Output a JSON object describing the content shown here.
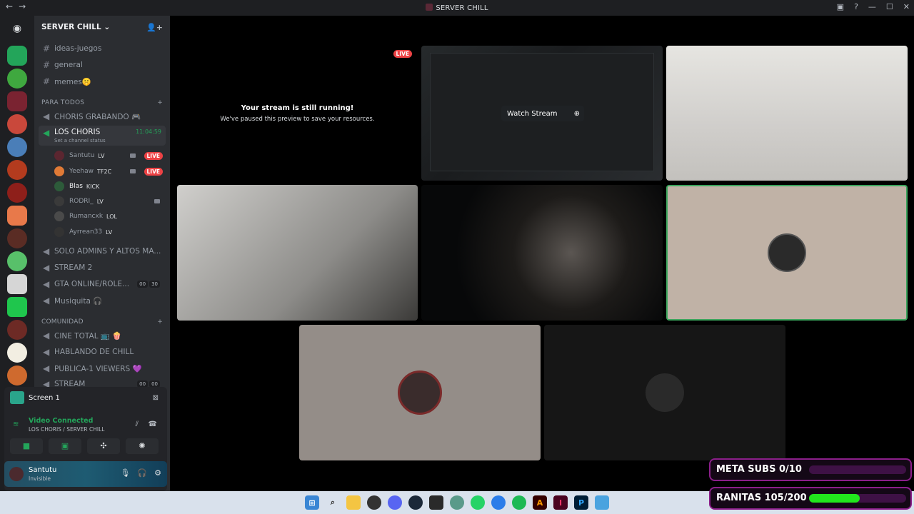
{
  "window": {
    "title": "SERVER CHILL"
  },
  "server": {
    "name": "SERVER CHILL"
  },
  "channels": {
    "text": [
      {
        "name": "ideas-juegos"
      },
      {
        "name": "general"
      },
      {
        "name": "memes🤫"
      }
    ],
    "cat1": "PARA TODOS",
    "voice1": "CHORIS GRABANDO 🎮",
    "active": {
      "name": "LOS CHORIS",
      "time": "11:04:59",
      "status": "Set a channel status"
    },
    "users": [
      {
        "name": "Santutu",
        "tag": "LV",
        "live": "LIVE"
      },
      {
        "name": "Yeehaw",
        "tag": "TF2C",
        "live": "LIVE"
      },
      {
        "name": "Blas",
        "tag": "KICK",
        "live": ""
      },
      {
        "name": "RODRI_",
        "tag": "LV",
        "live": ""
      },
      {
        "name": "Rumancxk",
        "tag": "LOL",
        "live": ""
      },
      {
        "name": "Ayrrean33",
        "tag": "LV",
        "live": ""
      }
    ],
    "voice_more": [
      {
        "name": "SOLO ADMINS Y ALTOS MA..."
      },
      {
        "name": "STREAM 2"
      },
      {
        "name": "GTA ONLINE/ROLE...",
        "b1": "00",
        "b2": "30"
      },
      {
        "name": "Musiquita 🎧"
      }
    ],
    "cat2": "COMUNIDAD",
    "voice2": [
      {
        "name": "CINE TOTAL 📺 🍿"
      },
      {
        "name": "HABLANDO DE CHILL"
      },
      {
        "name": "PUBLICA-1 VIEWERS 💜"
      },
      {
        "name": "STREAM",
        "b1": "00",
        "b2": "00"
      }
    ]
  },
  "voice_panel": {
    "screen_label": "Screen 1",
    "status": "Video Connected",
    "location": "LOS CHORIS / SERVER CHILL"
  },
  "userbar": {
    "name": "Santutu",
    "status": "Invisible"
  },
  "stage": {
    "live_badge": "LIVE",
    "paused_title": "Your stream is still running!",
    "paused_sub": "We've paused this preview to save your resources.",
    "watch_label": "Watch Stream"
  },
  "overlays": {
    "meta_subs": {
      "label": "META SUBS 0/10",
      "progress": 0.0
    },
    "ranitas": {
      "label": "RANITAS 105/200",
      "progress": 0.525
    }
  },
  "colors": {
    "live": "#ed4245",
    "connected": "#23a55a",
    "speaking": "#3ba55d"
  }
}
